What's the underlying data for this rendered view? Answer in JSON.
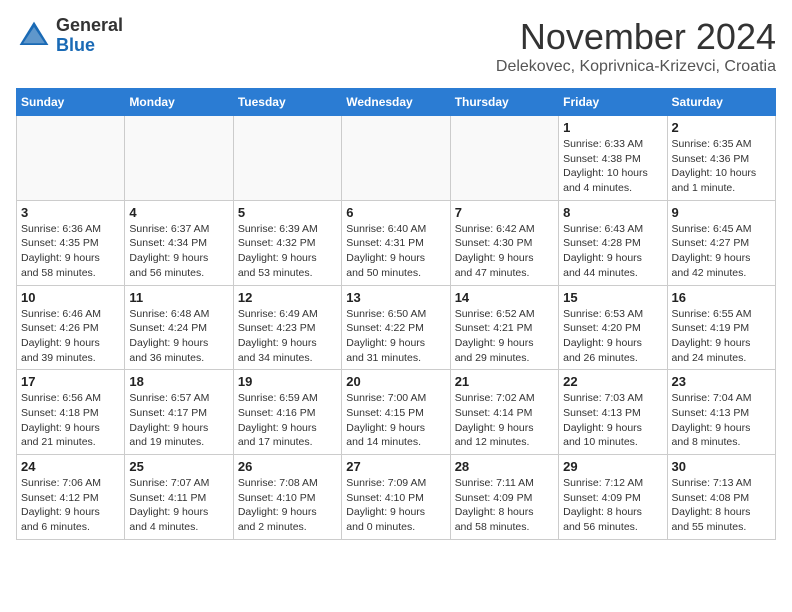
{
  "header": {
    "logo_general": "General",
    "logo_blue": "Blue",
    "month_title": "November 2024",
    "subtitle": "Delekovec, Koprivnica-Krizevci, Croatia"
  },
  "weekdays": [
    "Sunday",
    "Monday",
    "Tuesday",
    "Wednesday",
    "Thursday",
    "Friday",
    "Saturday"
  ],
  "weeks": [
    [
      {
        "day": "",
        "info": ""
      },
      {
        "day": "",
        "info": ""
      },
      {
        "day": "",
        "info": ""
      },
      {
        "day": "",
        "info": ""
      },
      {
        "day": "",
        "info": ""
      },
      {
        "day": "1",
        "info": "Sunrise: 6:33 AM\nSunset: 4:38 PM\nDaylight: 10 hours\nand 4 minutes."
      },
      {
        "day": "2",
        "info": "Sunrise: 6:35 AM\nSunset: 4:36 PM\nDaylight: 10 hours\nand 1 minute."
      }
    ],
    [
      {
        "day": "3",
        "info": "Sunrise: 6:36 AM\nSunset: 4:35 PM\nDaylight: 9 hours\nand 58 minutes."
      },
      {
        "day": "4",
        "info": "Sunrise: 6:37 AM\nSunset: 4:34 PM\nDaylight: 9 hours\nand 56 minutes."
      },
      {
        "day": "5",
        "info": "Sunrise: 6:39 AM\nSunset: 4:32 PM\nDaylight: 9 hours\nand 53 minutes."
      },
      {
        "day": "6",
        "info": "Sunrise: 6:40 AM\nSunset: 4:31 PM\nDaylight: 9 hours\nand 50 minutes."
      },
      {
        "day": "7",
        "info": "Sunrise: 6:42 AM\nSunset: 4:30 PM\nDaylight: 9 hours\nand 47 minutes."
      },
      {
        "day": "8",
        "info": "Sunrise: 6:43 AM\nSunset: 4:28 PM\nDaylight: 9 hours\nand 44 minutes."
      },
      {
        "day": "9",
        "info": "Sunrise: 6:45 AM\nSunset: 4:27 PM\nDaylight: 9 hours\nand 42 minutes."
      }
    ],
    [
      {
        "day": "10",
        "info": "Sunrise: 6:46 AM\nSunset: 4:26 PM\nDaylight: 9 hours\nand 39 minutes."
      },
      {
        "day": "11",
        "info": "Sunrise: 6:48 AM\nSunset: 4:24 PM\nDaylight: 9 hours\nand 36 minutes."
      },
      {
        "day": "12",
        "info": "Sunrise: 6:49 AM\nSunset: 4:23 PM\nDaylight: 9 hours\nand 34 minutes."
      },
      {
        "day": "13",
        "info": "Sunrise: 6:50 AM\nSunset: 4:22 PM\nDaylight: 9 hours\nand 31 minutes."
      },
      {
        "day": "14",
        "info": "Sunrise: 6:52 AM\nSunset: 4:21 PM\nDaylight: 9 hours\nand 29 minutes."
      },
      {
        "day": "15",
        "info": "Sunrise: 6:53 AM\nSunset: 4:20 PM\nDaylight: 9 hours\nand 26 minutes."
      },
      {
        "day": "16",
        "info": "Sunrise: 6:55 AM\nSunset: 4:19 PM\nDaylight: 9 hours\nand 24 minutes."
      }
    ],
    [
      {
        "day": "17",
        "info": "Sunrise: 6:56 AM\nSunset: 4:18 PM\nDaylight: 9 hours\nand 21 minutes."
      },
      {
        "day": "18",
        "info": "Sunrise: 6:57 AM\nSunset: 4:17 PM\nDaylight: 9 hours\nand 19 minutes."
      },
      {
        "day": "19",
        "info": "Sunrise: 6:59 AM\nSunset: 4:16 PM\nDaylight: 9 hours\nand 17 minutes."
      },
      {
        "day": "20",
        "info": "Sunrise: 7:00 AM\nSunset: 4:15 PM\nDaylight: 9 hours\nand 14 minutes."
      },
      {
        "day": "21",
        "info": "Sunrise: 7:02 AM\nSunset: 4:14 PM\nDaylight: 9 hours\nand 12 minutes."
      },
      {
        "day": "22",
        "info": "Sunrise: 7:03 AM\nSunset: 4:13 PM\nDaylight: 9 hours\nand 10 minutes."
      },
      {
        "day": "23",
        "info": "Sunrise: 7:04 AM\nSunset: 4:13 PM\nDaylight: 9 hours\nand 8 minutes."
      }
    ],
    [
      {
        "day": "24",
        "info": "Sunrise: 7:06 AM\nSunset: 4:12 PM\nDaylight: 9 hours\nand 6 minutes."
      },
      {
        "day": "25",
        "info": "Sunrise: 7:07 AM\nSunset: 4:11 PM\nDaylight: 9 hours\nand 4 minutes."
      },
      {
        "day": "26",
        "info": "Sunrise: 7:08 AM\nSunset: 4:10 PM\nDaylight: 9 hours\nand 2 minutes."
      },
      {
        "day": "27",
        "info": "Sunrise: 7:09 AM\nSunset: 4:10 PM\nDaylight: 9 hours\nand 0 minutes."
      },
      {
        "day": "28",
        "info": "Sunrise: 7:11 AM\nSunset: 4:09 PM\nDaylight: 8 hours\nand 58 minutes."
      },
      {
        "day": "29",
        "info": "Sunrise: 7:12 AM\nSunset: 4:09 PM\nDaylight: 8 hours\nand 56 minutes."
      },
      {
        "day": "30",
        "info": "Sunrise: 7:13 AM\nSunset: 4:08 PM\nDaylight: 8 hours\nand 55 minutes."
      }
    ]
  ]
}
